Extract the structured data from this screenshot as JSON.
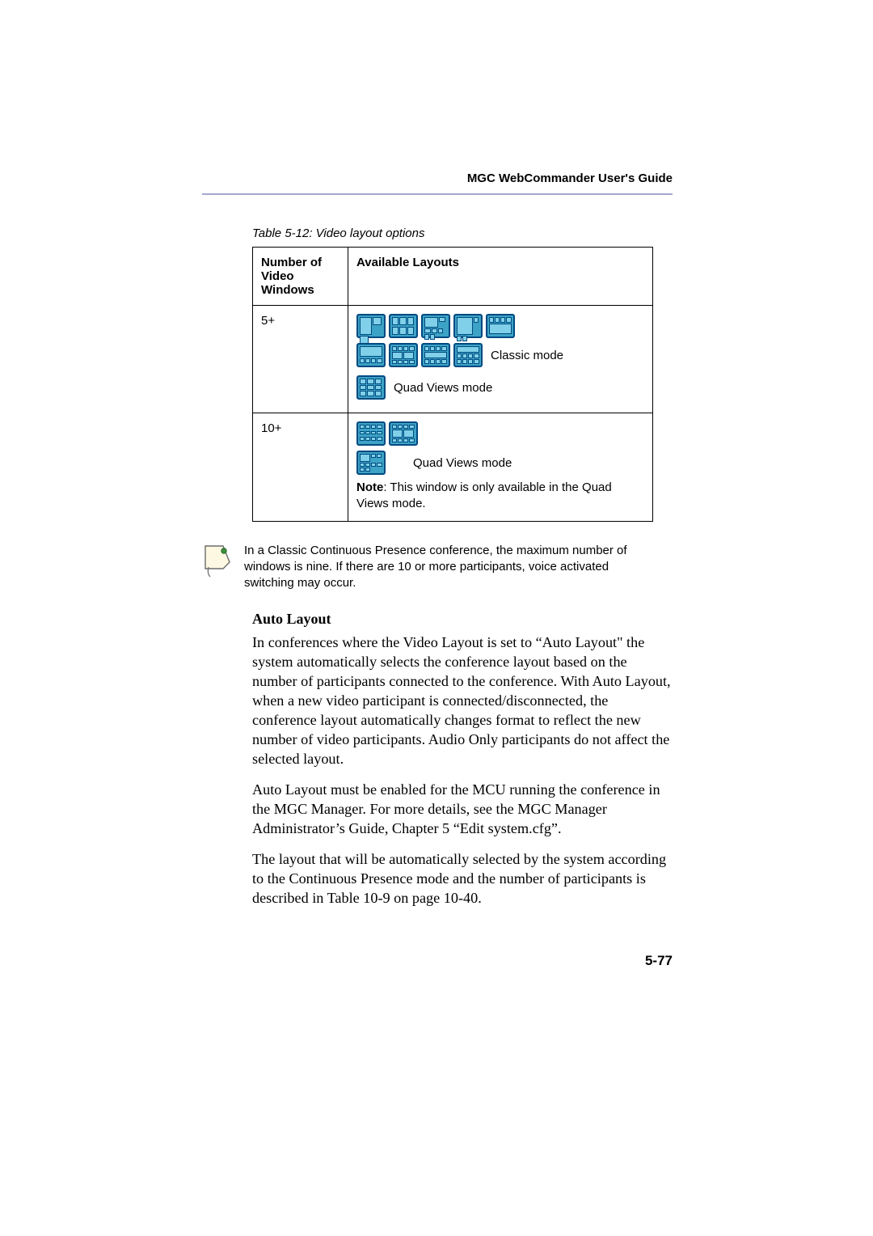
{
  "header": {
    "guide_title": "MGC WebCommander User's Guide"
  },
  "table": {
    "caption": "Table 5-12: Video layout options",
    "headers": {
      "col1": "Number of Video Windows",
      "col2": "Available Layouts"
    },
    "rows": [
      {
        "windows": "5+",
        "classic_label": "Classic mode",
        "quad_label": "Quad Views mode"
      },
      {
        "windows": "10+",
        "quad_label": "Quad Views mode",
        "note_prefix": "Note",
        "note_body": ": This window is only available in the Quad Views mode."
      }
    ]
  },
  "info_note": "In a Classic Continuous Presence conference, the maximum number of windows is nine. If there are 10 or more participants, voice activated switching may occur.",
  "section": {
    "heading": "Auto Layout",
    "para1": "In conferences where the Video Layout is set to “Auto Layout\" the system automatically selects the conference layout based on the number of participants connected to the conference. With Auto Layout, when a new video participant is connected/disconnected, the conference layout automatically changes format to reflect the new number of video participants. Audio Only participants do not affect the selected layout.",
    "para2": "Auto Layout must be enabled for the MCU running the conference in the MGC Manager. For more details, see the MGC Manager Administrator’s Guide, Chapter 5 “Edit system.cfg”.",
    "para3": "The layout that will be automatically selected by the system according to the Continuous Presence mode and the number of participants is described in Table 10-9 on page 10-40."
  },
  "page_number": "5-77"
}
